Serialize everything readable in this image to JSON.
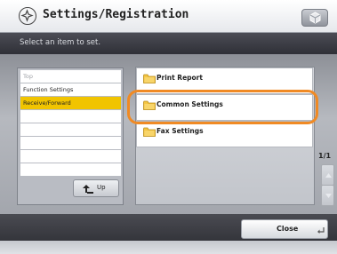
{
  "header": {
    "title": "Settings/Registration",
    "settings_icon": "settings-gear-icon",
    "top_button_icon": "box-icon"
  },
  "instruction": "Select an item to set.",
  "tree": {
    "items": [
      {
        "label": "Top",
        "state": "dim"
      },
      {
        "label": "Function Settings",
        "state": "normal"
      },
      {
        "label": "Receive/Forward",
        "state": "selected"
      },
      {
        "label": "",
        "state": "normal"
      },
      {
        "label": "",
        "state": "normal"
      },
      {
        "label": "",
        "state": "normal"
      },
      {
        "label": "",
        "state": "normal"
      },
      {
        "label": "",
        "state": "normal"
      }
    ],
    "up_label": "Up",
    "up_icon": "up-arrow-icon"
  },
  "menu": {
    "items": [
      {
        "label": "Print Report",
        "icon": "folder-icon"
      },
      {
        "label": "Common Settings",
        "icon": "folder-icon",
        "highlighted": true
      },
      {
        "label": "Fax Settings",
        "icon": "folder-icon"
      }
    ]
  },
  "pagination": {
    "label": "1/1"
  },
  "footer": {
    "close_label": "Close",
    "close_icon": "enter-icon"
  },
  "colors": {
    "selected": "#f1c400",
    "highlight": "#f08a24"
  }
}
